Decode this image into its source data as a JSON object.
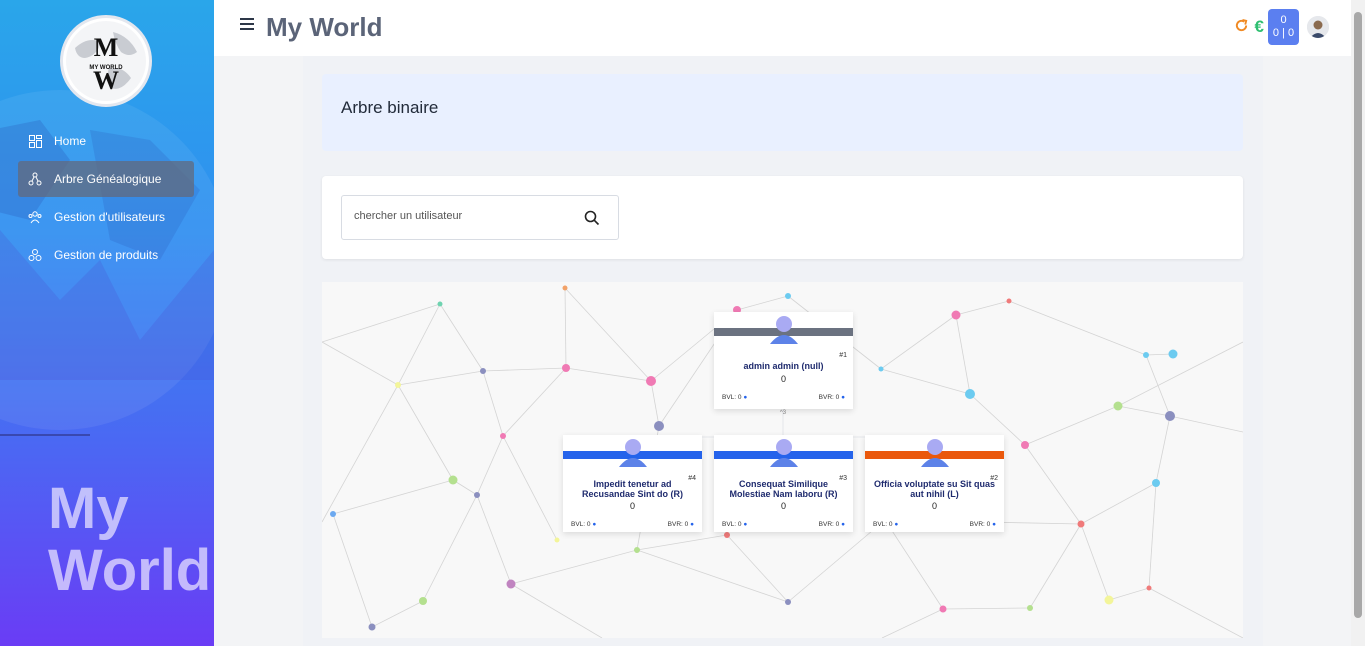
{
  "sidebar": {
    "logo_text": "MW",
    "logo_subtext": "MY WORLD",
    "brand_watermark_line1": "My",
    "brand_watermark_line2": "World",
    "items": [
      {
        "label": "Home",
        "icon": "grid-icon"
      },
      {
        "label": "Arbre Généalogique",
        "icon": "tree-icon",
        "active": true
      },
      {
        "label": "Gestion d'utilisateurs",
        "icon": "users-icon"
      },
      {
        "label": "Gestion de produits",
        "icon": "products-icon"
      }
    ]
  },
  "topbar": {
    "title": "My World",
    "euro_symbol": "€",
    "counter_top": "0",
    "counter_bottom": "0 | 0"
  },
  "page": {
    "heading": "Arbre binaire",
    "search_placeholder": "chercher un utilisateur"
  },
  "tree": {
    "connector_label": "^3",
    "nodes": [
      {
        "id": "#1",
        "name": "admin admin (null)",
        "value": "0",
        "bvl": "BVL: 0",
        "bvr": "BVR: 0",
        "bar_color": "#6b7280"
      },
      {
        "id": "#4",
        "name": "Impedit tenetur ad Recusandae Sint do (R)",
        "value": "0",
        "bvl": "BVL: 0",
        "bvr": "BVR: 0",
        "bar_color": "#2563eb"
      },
      {
        "id": "#3",
        "name": "Consequat Similique Molestiae Nam laboru (R)",
        "value": "0",
        "bvl": "BVL: 0",
        "bvr": "BVR: 0",
        "bar_color": "#2563eb"
      },
      {
        "id": "#2",
        "name": "Officia voluptate su Sit quas aut nihil (L)",
        "value": "0",
        "bvl": "BVL: 0",
        "bvr": "BVR: 0",
        "bar_color": "#ea580c"
      }
    ]
  },
  "colors": {
    "accent": "#5b7ff0",
    "refresh": "#f08a24",
    "euro": "#2fbf71",
    "sidebar_top": "#2aa6ea",
    "sidebar_bottom": "#6a3cf5"
  }
}
